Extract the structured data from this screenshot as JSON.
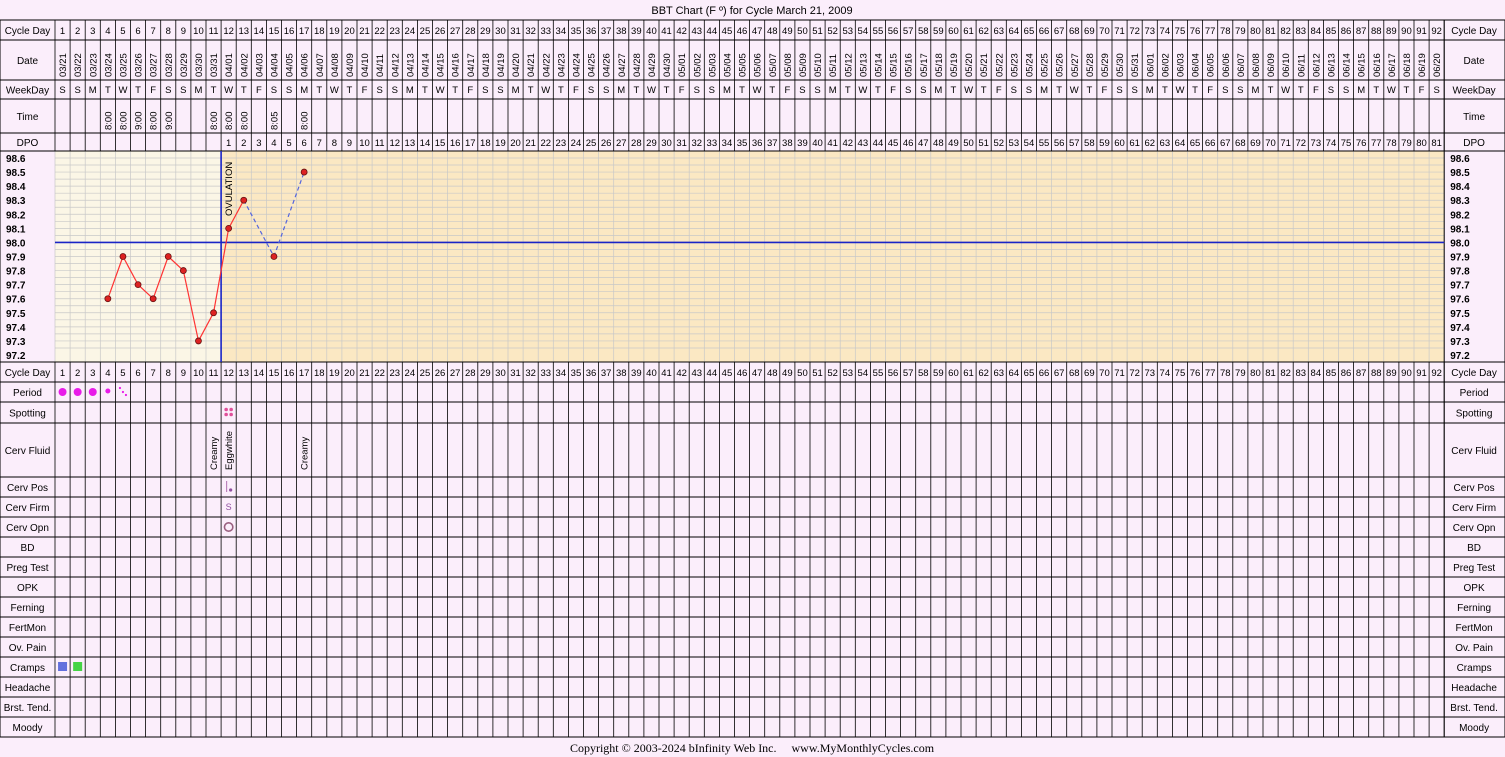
{
  "title": "BBT Chart (F º) for Cycle March 21, 2009",
  "row_labels": {
    "cycle_day": "Cycle Day",
    "date": "Date",
    "weekday": "WeekDay",
    "time": "Time",
    "dpo": "DPO",
    "period": "Period",
    "spotting": "Spotting",
    "cerv_fluid": "Cerv Fluid",
    "cerv_pos": "Cerv Pos",
    "cerv_firm": "Cerv Firm",
    "cerv_opn": "Cerv Opn",
    "bd": "BD",
    "preg_test": "Preg Test",
    "opk": "OPK",
    "ferning": "Ferning",
    "fertmon": "FertMon",
    "ov_pain": "Ov. Pain",
    "cramps": "Cramps",
    "headache": "Headache",
    "brst_tend": "Brst. Tend.",
    "moody": "Moody"
  },
  "cycle_days": 92,
  "dates": [
    "03/21",
    "03/22",
    "03/23",
    "03/24",
    "03/25",
    "03/26",
    "03/27",
    "03/28",
    "03/29",
    "03/30",
    "03/31",
    "04/01",
    "04/02",
    "04/03",
    "04/04",
    "04/05",
    "04/06",
    "04/07",
    "04/08",
    "04/09",
    "04/10",
    "04/11",
    "04/12",
    "04/13",
    "04/14",
    "04/15",
    "04/16",
    "04/17",
    "04/18",
    "04/19",
    "04/20",
    "04/21",
    "04/22",
    "04/23",
    "04/24",
    "04/25",
    "04/26",
    "04/27",
    "04/28",
    "04/29",
    "04/30",
    "05/01",
    "05/02",
    "05/03",
    "05/04",
    "05/05",
    "05/06",
    "05/07",
    "05/08",
    "05/09",
    "05/10",
    "05/11",
    "05/12",
    "05/13",
    "05/14",
    "05/15",
    "05/16",
    "05/17",
    "05/18",
    "05/19",
    "05/20",
    "05/21",
    "05/22",
    "05/23",
    "05/24",
    "05/25",
    "05/26",
    "05/27",
    "05/28",
    "05/29",
    "05/30",
    "05/31",
    "06/01",
    "06/02",
    "06/03",
    "06/04",
    "06/05",
    "06/06",
    "06/07",
    "06/08",
    "06/09",
    "06/10",
    "06/11",
    "06/12",
    "06/13",
    "06/14",
    "06/15",
    "06/16",
    "06/17",
    "06/18",
    "06/19",
    "06/20"
  ],
  "weekdays": [
    "S",
    "S",
    "M",
    "T",
    "W",
    "T",
    "F",
    "S",
    "S",
    "M",
    "T",
    "W",
    "T",
    "F",
    "S",
    "S",
    "M",
    "T",
    "W",
    "T",
    "F",
    "S",
    "S",
    "M",
    "T",
    "W",
    "T",
    "F",
    "S",
    "S",
    "M",
    "T",
    "W",
    "T",
    "F",
    "S",
    "S",
    "M",
    "T",
    "W",
    "T",
    "F",
    "S",
    "S",
    "M",
    "T",
    "W",
    "T",
    "F",
    "S",
    "S",
    "M",
    "T",
    "W",
    "T",
    "F",
    "S",
    "S",
    "M",
    "T",
    "W",
    "T",
    "F",
    "S",
    "S",
    "M",
    "T",
    "W",
    "T",
    "F",
    "S",
    "S",
    "M",
    "T",
    "W",
    "T",
    "F",
    "S",
    "S",
    "M",
    "T",
    "W",
    "T",
    "F",
    "S",
    "S",
    "M",
    "T",
    "W",
    "T",
    "F",
    "S"
  ],
  "times": [
    "",
    "",
    "",
    "8:00",
    "8:00",
    "9:00",
    "8:00",
    "9:00",
    "",
    "",
    "8:00",
    "8:00",
    "8:00",
    "",
    "8:05",
    "",
    "8:00"
  ],
  "dpo_start_day": 12,
  "dpo_count": 81,
  "ovulation_day": 11,
  "ovulation_label": "OVULATION",
  "coverline": 98.0,
  "colors": {
    "background": "#fbeefb",
    "preov_fill": "#fbf6e6",
    "postov_fill": "#fbe8c3",
    "grid": "#aaaaaa",
    "line": "#ff3333",
    "point": "#dd2222",
    "coverline": "#1a24c6",
    "period": "#e81be8",
    "spotting": "#e0509a"
  },
  "chart_data": {
    "type": "line",
    "ylim": [
      97.2,
      98.6
    ],
    "yticks": [
      "98.6",
      "98.5",
      "98.4",
      "98.3",
      "98.2",
      "98.1",
      "98.0",
      "97.9",
      "97.8",
      "97.7",
      "97.6",
      "97.5",
      "97.4",
      "97.3",
      "97.2"
    ],
    "points": [
      {
        "day": 4,
        "temp": 97.6
      },
      {
        "day": 5,
        "temp": 97.9
      },
      {
        "day": 6,
        "temp": 97.7
      },
      {
        "day": 7,
        "temp": 97.6
      },
      {
        "day": 8,
        "temp": 97.9
      },
      {
        "day": 9,
        "temp": 97.8
      },
      {
        "day": 10,
        "temp": 97.3
      },
      {
        "day": 11,
        "temp": 97.5
      },
      {
        "day": 12,
        "temp": 98.1
      },
      {
        "day": 13,
        "temp": 98.3
      },
      {
        "day": 15,
        "temp": 97.9
      },
      {
        "day": 17,
        "temp": 98.5
      }
    ]
  },
  "period": [
    {
      "day": 1,
      "level": "heavy"
    },
    {
      "day": 2,
      "level": "heavy"
    },
    {
      "day": 3,
      "level": "heavy"
    },
    {
      "day": 4,
      "level": "light"
    },
    {
      "day": 5,
      "level": "spotting"
    }
  ],
  "spotting_days": [
    12
  ],
  "cerv_fluid": [
    {
      "day": 11,
      "value": "Creamy"
    },
    {
      "day": 12,
      "value": "Eggwhite"
    },
    {
      "day": 17,
      "value": "Creamy"
    }
  ],
  "cerv_pos": [
    {
      "day": 12,
      "value": "low"
    }
  ],
  "cerv_firm": [
    {
      "day": 12,
      "value": "S"
    }
  ],
  "cerv_opn": [
    {
      "day": 12,
      "value": "open"
    }
  ],
  "cramps": [
    {
      "day": 1,
      "color": "#6270dd"
    },
    {
      "day": 2,
      "color": "#44d444"
    }
  ],
  "copyright": "Copyright © 2003-2024 bInfinity Web Inc.     www.MyMonthlyCycles.com"
}
